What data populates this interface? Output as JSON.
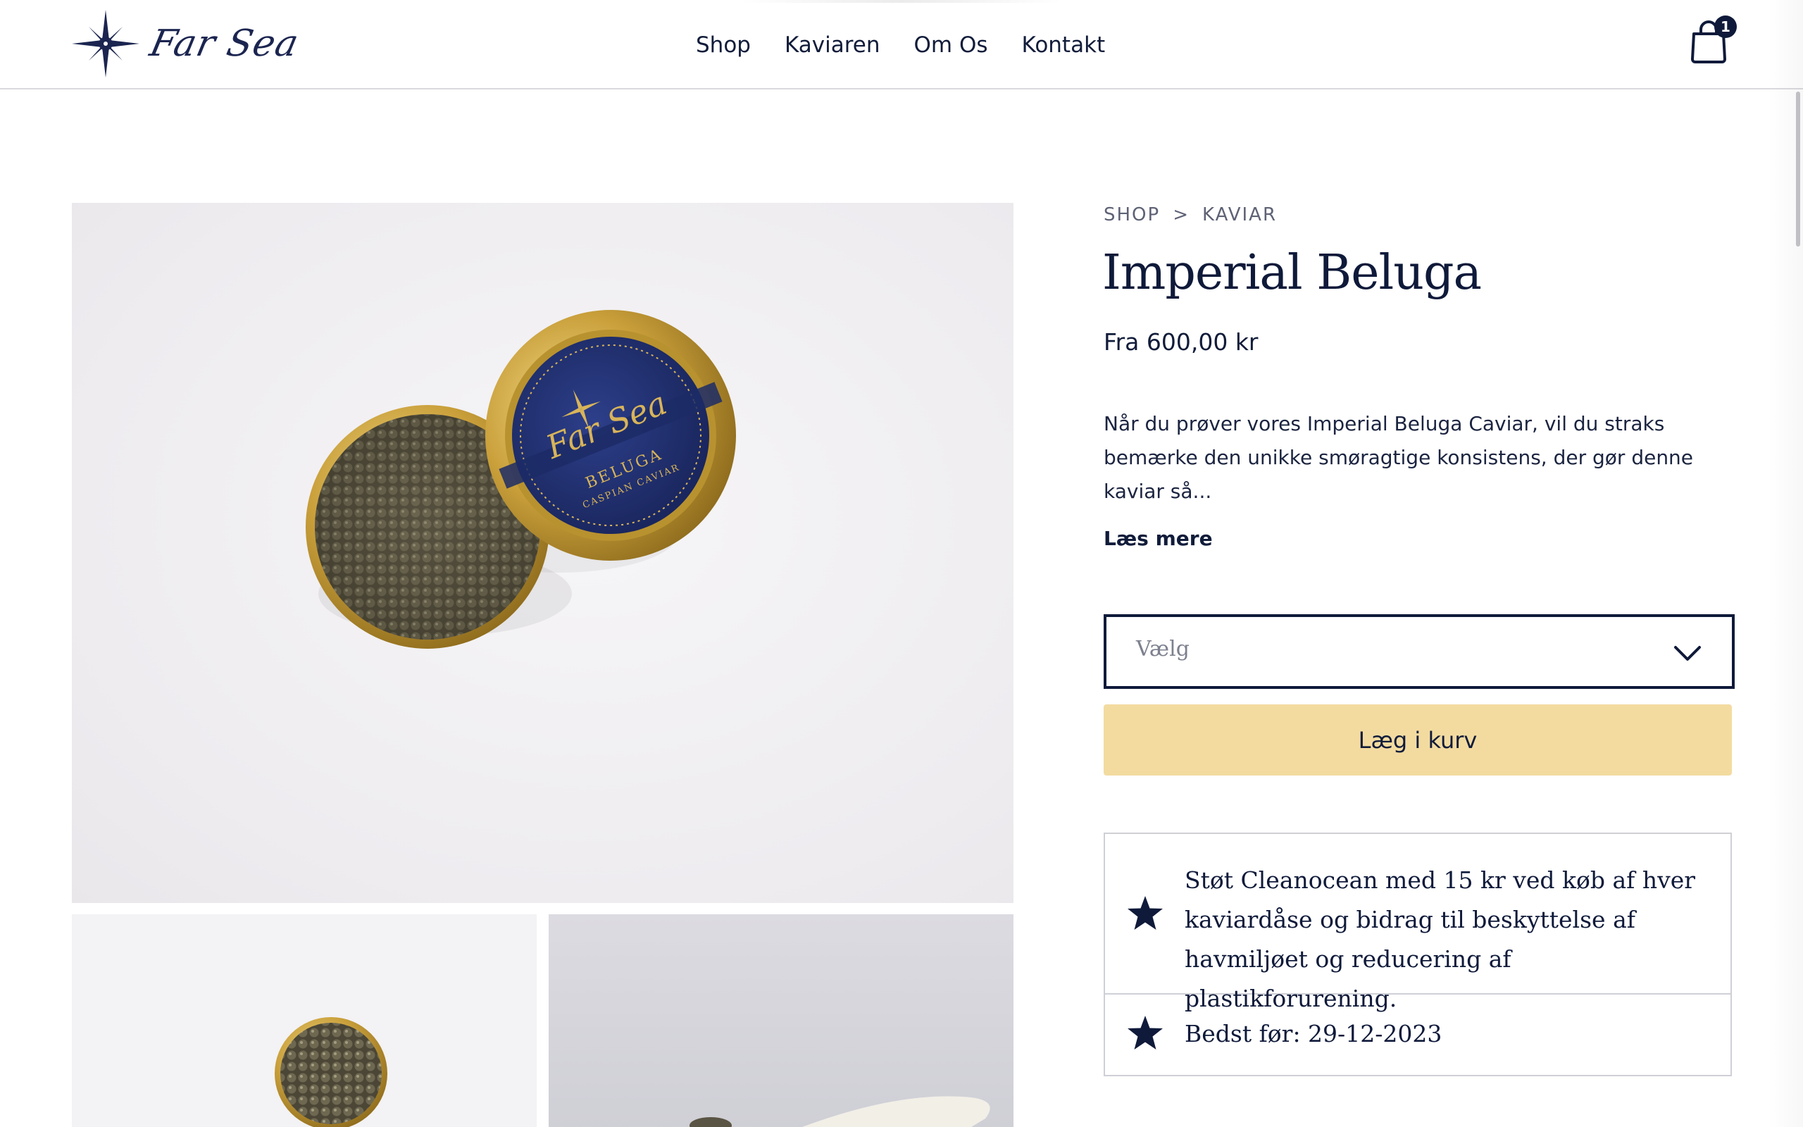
{
  "brand": {
    "name": "Far Sea"
  },
  "nav": {
    "items": [
      {
        "label": "Shop"
      },
      {
        "label": "Kaviaren"
      },
      {
        "label": "Om Os"
      },
      {
        "label": "Kontakt"
      }
    ]
  },
  "cart": {
    "count": "1"
  },
  "product": {
    "breadcrumb": {
      "shop": "SHOP",
      "separator": ">",
      "category": "KAVIAR"
    },
    "title": "Imperial Beluga",
    "price": "Fra 600,00 kr",
    "description": "Når du prøver vores Imperial Beluga Caviar, vil du straks bemærke den unikke smøragtige konsistens, der gør denne kaviar så...",
    "read_more": "Læs mere",
    "select_placeholder": "Vælg",
    "add_to_cart": "Læg i kurv",
    "image_tin_label": {
      "brand": "Far Sea",
      "variety": "BELUGA",
      "subtitle": "CASPIAN CAVIAR"
    },
    "info": [
      {
        "text": "Støt Cleanocean med 15 kr ved køb af hver kaviardåse og bidrag til beskyttelse af havmiljøet og reducering af plastikforurening.",
        "icon": "star-icon"
      },
      {
        "text": "Bedst før: 29-12-2023",
        "icon": "star-icon"
      }
    ]
  },
  "colors": {
    "navy": "#0f1a3a",
    "accent": "#f3dba0",
    "gold": "#c9a13a"
  }
}
